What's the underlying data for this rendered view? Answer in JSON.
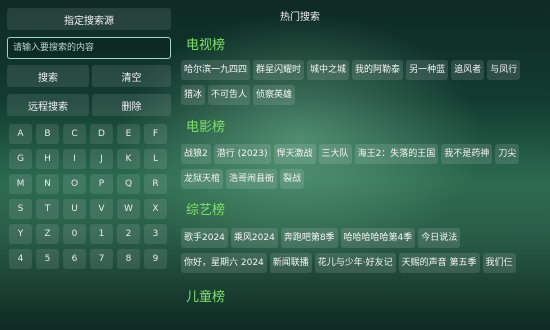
{
  "left": {
    "header": "指定搜索源",
    "search_placeholder": "请输入要搜索的内容",
    "search_button": "搜索",
    "clear_button": "清空",
    "remote_search_button": "远程搜索",
    "delete_button": "删除",
    "keys": [
      "A",
      "B",
      "C",
      "D",
      "E",
      "F",
      "G",
      "H",
      "I",
      "J",
      "K",
      "L",
      "M",
      "N",
      "O",
      "P",
      "Q",
      "R",
      "S",
      "T",
      "U",
      "V",
      "W",
      "X",
      "Y",
      "Z",
      "0",
      "1",
      "2",
      "3",
      "4",
      "5",
      "6",
      "7",
      "8",
      "9"
    ]
  },
  "right": {
    "title": "热门搜索",
    "sections": [
      {
        "name": "电视榜",
        "tags": [
          "哈尔滨一九四四",
          "群星闪耀时",
          "城中之城",
          "我的阿勒泰",
          "另一种蓝",
          "追风者",
          "与凤行",
          "猎冰",
          "不可告人",
          "侦察英雄"
        ]
      },
      {
        "name": "电影榜",
        "tags": [
          "战狼2",
          "潜行 (2023)",
          "悍天激战",
          "三大队",
          "海王2：失落的王国",
          "我不是药神",
          "刀尖",
          "龙狱天棺",
          "浩哥闹县衙",
          "裂战"
        ]
      },
      {
        "name": "综艺榜",
        "tags": [
          "歌手2024",
          "乘风2024",
          "奔跑吧第8季",
          "哈哈哈哈哈第4季",
          "今日说法",
          "你好，星期六 2024",
          "新闻联播",
          "花儿与少年·好友记",
          "天赐的声音 第五季",
          "我们仨"
        ]
      },
      {
        "name": "儿童榜",
        "tags": []
      }
    ]
  }
}
